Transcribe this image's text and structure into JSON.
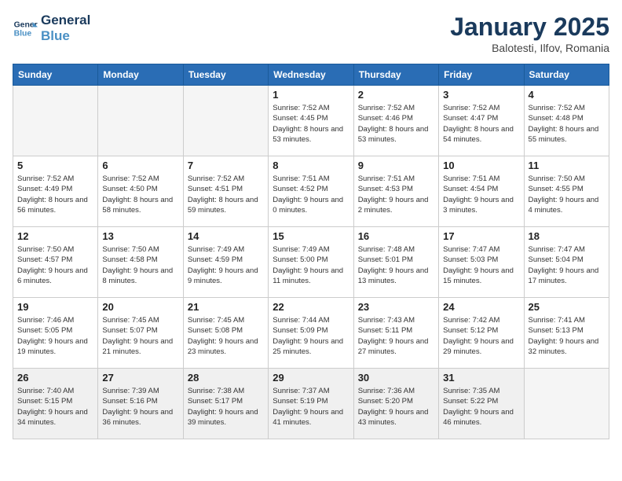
{
  "header": {
    "logo_line1": "General",
    "logo_line2": "Blue",
    "month": "January 2025",
    "location": "Balotesti, Ilfov, Romania"
  },
  "weekdays": [
    "Sunday",
    "Monday",
    "Tuesday",
    "Wednesday",
    "Thursday",
    "Friday",
    "Saturday"
  ],
  "weeks": [
    [
      {
        "day": "",
        "sunrise": "",
        "sunset": "",
        "daylight": ""
      },
      {
        "day": "",
        "sunrise": "",
        "sunset": "",
        "daylight": ""
      },
      {
        "day": "",
        "sunrise": "",
        "sunset": "",
        "daylight": ""
      },
      {
        "day": "1",
        "sunrise": "Sunrise: 7:52 AM",
        "sunset": "Sunset: 4:45 PM",
        "daylight": "Daylight: 8 hours and 53 minutes."
      },
      {
        "day": "2",
        "sunrise": "Sunrise: 7:52 AM",
        "sunset": "Sunset: 4:46 PM",
        "daylight": "Daylight: 8 hours and 53 minutes."
      },
      {
        "day": "3",
        "sunrise": "Sunrise: 7:52 AM",
        "sunset": "Sunset: 4:47 PM",
        "daylight": "Daylight: 8 hours and 54 minutes."
      },
      {
        "day": "4",
        "sunrise": "Sunrise: 7:52 AM",
        "sunset": "Sunset: 4:48 PM",
        "daylight": "Daylight: 8 hours and 55 minutes."
      }
    ],
    [
      {
        "day": "5",
        "sunrise": "Sunrise: 7:52 AM",
        "sunset": "Sunset: 4:49 PM",
        "daylight": "Daylight: 8 hours and 56 minutes."
      },
      {
        "day": "6",
        "sunrise": "Sunrise: 7:52 AM",
        "sunset": "Sunset: 4:50 PM",
        "daylight": "Daylight: 8 hours and 58 minutes."
      },
      {
        "day": "7",
        "sunrise": "Sunrise: 7:52 AM",
        "sunset": "Sunset: 4:51 PM",
        "daylight": "Daylight: 8 hours and 59 minutes."
      },
      {
        "day": "8",
        "sunrise": "Sunrise: 7:51 AM",
        "sunset": "Sunset: 4:52 PM",
        "daylight": "Daylight: 9 hours and 0 minutes."
      },
      {
        "day": "9",
        "sunrise": "Sunrise: 7:51 AM",
        "sunset": "Sunset: 4:53 PM",
        "daylight": "Daylight: 9 hours and 2 minutes."
      },
      {
        "day": "10",
        "sunrise": "Sunrise: 7:51 AM",
        "sunset": "Sunset: 4:54 PM",
        "daylight": "Daylight: 9 hours and 3 minutes."
      },
      {
        "day": "11",
        "sunrise": "Sunrise: 7:50 AM",
        "sunset": "Sunset: 4:55 PM",
        "daylight": "Daylight: 9 hours and 4 minutes."
      }
    ],
    [
      {
        "day": "12",
        "sunrise": "Sunrise: 7:50 AM",
        "sunset": "Sunset: 4:57 PM",
        "daylight": "Daylight: 9 hours and 6 minutes."
      },
      {
        "day": "13",
        "sunrise": "Sunrise: 7:50 AM",
        "sunset": "Sunset: 4:58 PM",
        "daylight": "Daylight: 9 hours and 8 minutes."
      },
      {
        "day": "14",
        "sunrise": "Sunrise: 7:49 AM",
        "sunset": "Sunset: 4:59 PM",
        "daylight": "Daylight: 9 hours and 9 minutes."
      },
      {
        "day": "15",
        "sunrise": "Sunrise: 7:49 AM",
        "sunset": "Sunset: 5:00 PM",
        "daylight": "Daylight: 9 hours and 11 minutes."
      },
      {
        "day": "16",
        "sunrise": "Sunrise: 7:48 AM",
        "sunset": "Sunset: 5:01 PM",
        "daylight": "Daylight: 9 hours and 13 minutes."
      },
      {
        "day": "17",
        "sunrise": "Sunrise: 7:47 AM",
        "sunset": "Sunset: 5:03 PM",
        "daylight": "Daylight: 9 hours and 15 minutes."
      },
      {
        "day": "18",
        "sunrise": "Sunrise: 7:47 AM",
        "sunset": "Sunset: 5:04 PM",
        "daylight": "Daylight: 9 hours and 17 minutes."
      }
    ],
    [
      {
        "day": "19",
        "sunrise": "Sunrise: 7:46 AM",
        "sunset": "Sunset: 5:05 PM",
        "daylight": "Daylight: 9 hours and 19 minutes."
      },
      {
        "day": "20",
        "sunrise": "Sunrise: 7:45 AM",
        "sunset": "Sunset: 5:07 PM",
        "daylight": "Daylight: 9 hours and 21 minutes."
      },
      {
        "day": "21",
        "sunrise": "Sunrise: 7:45 AM",
        "sunset": "Sunset: 5:08 PM",
        "daylight": "Daylight: 9 hours and 23 minutes."
      },
      {
        "day": "22",
        "sunrise": "Sunrise: 7:44 AM",
        "sunset": "Sunset: 5:09 PM",
        "daylight": "Daylight: 9 hours and 25 minutes."
      },
      {
        "day": "23",
        "sunrise": "Sunrise: 7:43 AM",
        "sunset": "Sunset: 5:11 PM",
        "daylight": "Daylight: 9 hours and 27 minutes."
      },
      {
        "day": "24",
        "sunrise": "Sunrise: 7:42 AM",
        "sunset": "Sunset: 5:12 PM",
        "daylight": "Daylight: 9 hours and 29 minutes."
      },
      {
        "day": "25",
        "sunrise": "Sunrise: 7:41 AM",
        "sunset": "Sunset: 5:13 PM",
        "daylight": "Daylight: 9 hours and 32 minutes."
      }
    ],
    [
      {
        "day": "26",
        "sunrise": "Sunrise: 7:40 AM",
        "sunset": "Sunset: 5:15 PM",
        "daylight": "Daylight: 9 hours and 34 minutes."
      },
      {
        "day": "27",
        "sunrise": "Sunrise: 7:39 AM",
        "sunset": "Sunset: 5:16 PM",
        "daylight": "Daylight: 9 hours and 36 minutes."
      },
      {
        "day": "28",
        "sunrise": "Sunrise: 7:38 AM",
        "sunset": "Sunset: 5:17 PM",
        "daylight": "Daylight: 9 hours and 39 minutes."
      },
      {
        "day": "29",
        "sunrise": "Sunrise: 7:37 AM",
        "sunset": "Sunset: 5:19 PM",
        "daylight": "Daylight: 9 hours and 41 minutes."
      },
      {
        "day": "30",
        "sunrise": "Sunrise: 7:36 AM",
        "sunset": "Sunset: 5:20 PM",
        "daylight": "Daylight: 9 hours and 43 minutes."
      },
      {
        "day": "31",
        "sunrise": "Sunrise: 7:35 AM",
        "sunset": "Sunset: 5:22 PM",
        "daylight": "Daylight: 9 hours and 46 minutes."
      },
      {
        "day": "",
        "sunrise": "",
        "sunset": "",
        "daylight": ""
      }
    ]
  ]
}
